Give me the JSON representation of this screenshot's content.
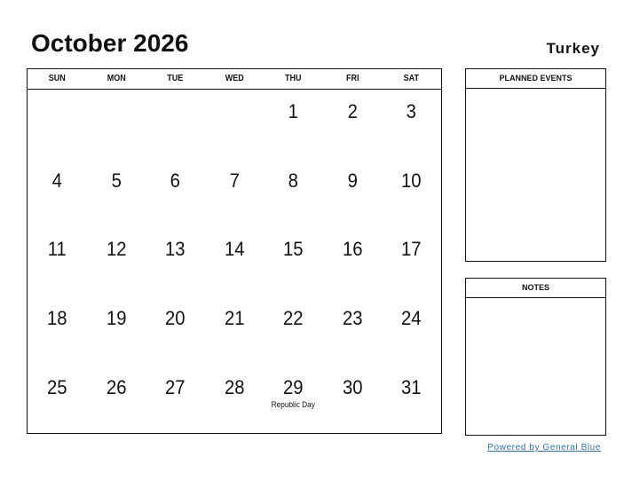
{
  "header": {
    "title": "October 2026",
    "country": "Turkey"
  },
  "calendar": {
    "weekdays": [
      "SUN",
      "MON",
      "TUE",
      "WED",
      "THU",
      "FRI",
      "SAT"
    ],
    "weeks": [
      [
        {
          "day": ""
        },
        {
          "day": ""
        },
        {
          "day": ""
        },
        {
          "day": ""
        },
        {
          "day": "1"
        },
        {
          "day": "2"
        },
        {
          "day": "3"
        }
      ],
      [
        {
          "day": "4"
        },
        {
          "day": "5"
        },
        {
          "day": "6"
        },
        {
          "day": "7"
        },
        {
          "day": "8"
        },
        {
          "day": "9"
        },
        {
          "day": "10"
        }
      ],
      [
        {
          "day": "11"
        },
        {
          "day": "12"
        },
        {
          "day": "13"
        },
        {
          "day": "14"
        },
        {
          "day": "15"
        },
        {
          "day": "16"
        },
        {
          "day": "17"
        }
      ],
      [
        {
          "day": "18"
        },
        {
          "day": "19"
        },
        {
          "day": "20"
        },
        {
          "day": "21"
        },
        {
          "day": "22"
        },
        {
          "day": "23"
        },
        {
          "day": "24"
        }
      ],
      [
        {
          "day": "25"
        },
        {
          "day": "26"
        },
        {
          "day": "27"
        },
        {
          "day": "28"
        },
        {
          "day": "29",
          "holiday": "Republic Day"
        },
        {
          "day": "30"
        },
        {
          "day": "31"
        }
      ]
    ]
  },
  "panels": {
    "planned_events": "PLANNED EVENTS",
    "notes": "NOTES"
  },
  "footer": {
    "powered_by": "Powered by General Blue"
  }
}
